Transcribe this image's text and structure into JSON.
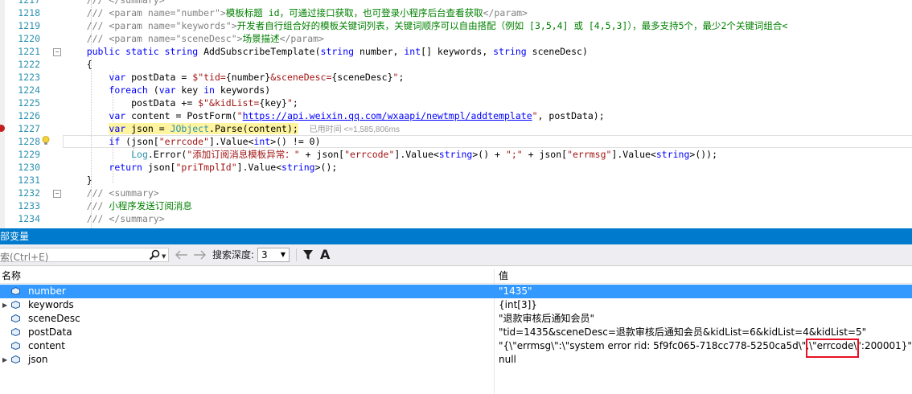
{
  "editor": {
    "lines": [
      {
        "num": "1217",
        "html": "<span class=\"doc\">/// &lt;/summary&gt;</span>"
      },
      {
        "num": "1218",
        "html": "<span class=\"doc\">/// &lt;param name=\"number\"&gt;</span><span class=\"cmt\">模板标题 id，可通过接口获取，也可登录小程序后台查看获取</span><span class=\"doc\">&lt;/param&gt;</span>"
      },
      {
        "num": "1219",
        "html": "<span class=\"doc\">/// &lt;param name=\"keywords\"&gt;</span><span class=\"cmt\">开发者自行组合好的模板关键词列表，关键词顺序可以自由搭配（例如 [3,5,4] 或 [4,5,3]），最多支持5个，最少2个关键词组合&lt;</span>"
      },
      {
        "num": "1220",
        "html": "<span class=\"doc\">/// &lt;param name=\"sceneDesc\"&gt;</span><span class=\"cmt\">场景描述</span><span class=\"doc\">&lt;/param&gt;</span>"
      },
      {
        "num": "1221",
        "html": "<span class=\"kw\">public static string</span> AddSubscribeTemplate(<span class=\"kw\">string</span> number, <span class=\"kw\">int</span>[] keywords, <span class=\"kw\">string</span> sceneDesc)"
      },
      {
        "num": "1222",
        "html": "{"
      },
      {
        "num": "1223",
        "html": "    <span class=\"kw\">var</span> postData = <span class=\"str\">$\"tid=</span>{number}<span class=\"str\">&amp;sceneDesc=</span>{sceneDesc}<span class=\"str\">\"</span>;"
      },
      {
        "num": "1224",
        "html": "    <span class=\"kw\">foreach</span> (<span class=\"kw\">var</span> key <span class=\"kw\">in</span> keywords)"
      },
      {
        "num": "1225",
        "html": "        postData += <span class=\"str\">$\"&amp;kidList=</span>{key}<span class=\"str\">\"</span>;"
      },
      {
        "num": "1226",
        "html": "    <span class=\"kw\">var</span> content = PostForm(<span class=\"str\">\"</span><span class=\"url\">https://api.weixin.qq.com/wxaapi/newtmpl/addtemplate</span><span class=\"str\">\"</span>, postData);"
      },
      {
        "num": "1227",
        "html": "    <span class=\"hl\"><span class=\"kw\">var</span> json = <span class=\"ty\">JObject</span>.Parse(content);</span>  <span class=\"perf\">已用时间 &lt;=1,585,806ms</span>"
      },
      {
        "num": "1228",
        "html": "    <span class=\"kw\">if</span> (json[<span class=\"str\">\"errcode\"</span>].Value&lt;<span class=\"kw\">int</span>&gt;() != 0)"
      },
      {
        "num": "1229",
        "html": "        <span class=\"ty\">Log</span>.Error(<span class=\"str\">\"添加订阅消息模板异常：\"</span> + json[<span class=\"str\">\"errcode\"</span>].Value&lt;<span class=\"kw\">string</span>&gt;() + <span class=\"str\">\";\"</span> + json[<span class=\"str\">\"errmsg\"</span>].Value&lt;<span class=\"kw\">string</span>&gt;());"
      },
      {
        "num": "1230",
        "html": "    <span class=\"kw\">return</span> json[<span class=\"str\">\"priTmplId\"</span>].Value&lt;<span class=\"kw\">string</span>&gt;();"
      },
      {
        "num": "1231",
        "html": "}"
      },
      {
        "num": "1232",
        "html": "<span class=\"doc\">/// &lt;summary&gt;</span>"
      },
      {
        "num": "1233",
        "html": "<span class=\"doc\">/// </span><span class=\"cmt\">小程序发送订阅消息</span>"
      },
      {
        "num": "1234",
        "html": "<span class=\"doc\">/// &lt;/summary&gt;</span>"
      }
    ]
  },
  "locals": {
    "title": "局部变量",
    "search_placeholder": "搜索(Ctrl+E)",
    "search_depth_label": "搜索深度:",
    "search_depth_value": "3",
    "col_name": "名称",
    "col_value": "值",
    "rows": [
      {
        "name": "number",
        "value": "\"1435\"",
        "expandable": false,
        "selected": true
      },
      {
        "name": "keywords",
        "value": "{int[3]}",
        "expandable": true,
        "selected": false
      },
      {
        "name": "sceneDesc",
        "value": "\"退款审核后通知会员\"",
        "expandable": false,
        "selected": false
      },
      {
        "name": "postData",
        "value": "\"tid=1435&sceneDesc=退款审核后通知会员&kidList=6&kidList=4&kidList=5\"",
        "expandable": false,
        "selected": false
      },
      {
        "name": "content",
        "value": "\"{\\\"errmsg\\\":\\\"system error rid: 5f9fc065-718cc778-5250ca5d\\\",\\\"errcode\\\":200001}\"",
        "expandable": false,
        "selected": false
      },
      {
        "name": "json",
        "value": "null",
        "expandable": true,
        "selected": false
      }
    ]
  },
  "colors": {
    "panel_title": "#007acc",
    "selected_row": "#3399ff",
    "highlight_box": "#e81123"
  }
}
